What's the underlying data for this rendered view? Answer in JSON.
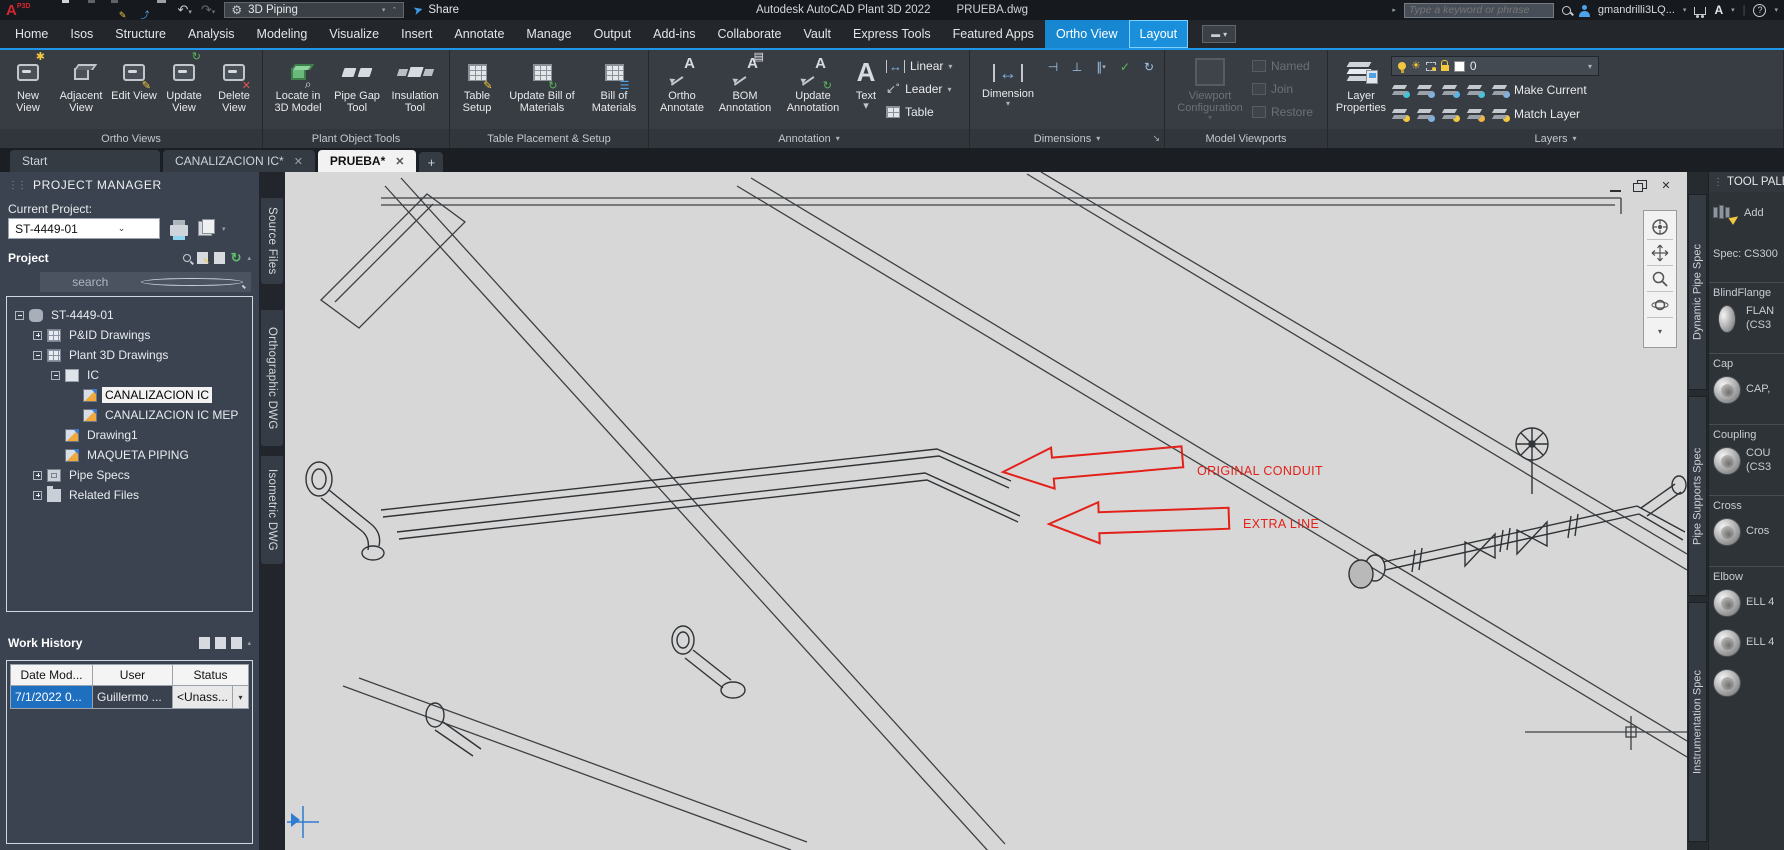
{
  "colors": {
    "accent": "#1787d2",
    "annotation_red": "#e32119",
    "selection_blue": "#1e6fc0",
    "canvas_gray": "#d7d7d7"
  },
  "title_bar": {
    "logo": "P3D",
    "workspace": "3D Piping",
    "share_label": "Share",
    "app_title": "Autodesk AutoCAD Plant 3D 2022",
    "doc_title": "PRUEBA.dwg",
    "search_placeholder": "Type a keyword or phrase",
    "user": "gmandrilli3LQ..."
  },
  "menu": {
    "tabs": [
      {
        "label": "Home"
      },
      {
        "label": "Isos"
      },
      {
        "label": "Structure"
      },
      {
        "label": "Analysis"
      },
      {
        "label": "Modeling"
      },
      {
        "label": "Visualize"
      },
      {
        "label": "Insert"
      },
      {
        "label": "Annotate"
      },
      {
        "label": "Manage"
      },
      {
        "label": "Output"
      },
      {
        "label": "Add-ins"
      },
      {
        "label": "Collaborate"
      },
      {
        "label": "Vault"
      },
      {
        "label": "Express Tools"
      },
      {
        "label": "Featured Apps"
      },
      {
        "label": "Ortho View",
        "active": true
      },
      {
        "label": "Layout",
        "active": true
      }
    ]
  },
  "ribbon": {
    "ortho_views": {
      "label": "Ortho Views",
      "buttons": [
        "New View",
        "Adjacent View",
        "Edit View",
        "Update View",
        "Delete View"
      ]
    },
    "plant_tools": {
      "label": "Plant Object Tools",
      "buttons": [
        "Locate in 3D Model",
        "Pipe Gap Tool",
        "Insulation Tool"
      ]
    },
    "table_setup": {
      "label": "Table Placement & Setup",
      "buttons": [
        "Table Setup",
        "Update Bill of Materials",
        "Bill of Materials"
      ]
    },
    "annotation": {
      "label": "Annotation",
      "buttons": [
        "Ortho Annotate",
        "BOM Annotation",
        "Update Annotation",
        "Text"
      ],
      "side": [
        "Linear",
        "Leader",
        "Table"
      ]
    },
    "dimensions": {
      "label": "Dimensions",
      "main": "Dimension"
    },
    "model_viewports": {
      "label": "Model Viewports",
      "main": "Viewport Configuration",
      "side": [
        "Named",
        "Join",
        "Restore"
      ]
    },
    "layers": {
      "label": "Layers",
      "main": "Layer Properties",
      "current_layer": "0",
      "actions": [
        "Make Current",
        "Match Layer"
      ]
    }
  },
  "file_tabs": {
    "tabs": [
      {
        "label": "Start"
      },
      {
        "label": "CANALIZACION IC*",
        "closable": true
      },
      {
        "label": "PRUEBA*",
        "closable": true,
        "active": true
      }
    ],
    "add": "+"
  },
  "project_manager": {
    "title": "PROJECT MANAGER",
    "current_project_label": "Current Project:",
    "current_project": "ST-4449-01",
    "section_title": "Project",
    "search_placeholder": "search",
    "tree": [
      {
        "label": "ST-4449-01"
      },
      {
        "label": "P&ID Drawings"
      },
      {
        "label": "Plant 3D Drawings"
      },
      {
        "label": "IC"
      },
      {
        "label": "CANALIZACION IC",
        "selected": true
      },
      {
        "label": "CANALIZACION IC MEP"
      },
      {
        "label": "Drawing1"
      },
      {
        "label": "MAQUETA PIPING"
      },
      {
        "label": "Pipe Specs"
      },
      {
        "label": "Related Files"
      }
    ],
    "work_history": {
      "title": "Work History",
      "columns": [
        "Date Mod...",
        "User",
        "Status"
      ],
      "row": {
        "date": "7/1/2022 0...",
        "user": "Guillermo ...",
        "status": "<Unass..."
      }
    }
  },
  "left_tabs": [
    {
      "label": "Source Files"
    },
    {
      "label": "Orthographic DWG"
    },
    {
      "label": "Isometric DWG"
    }
  ],
  "canvas": {
    "annotations": [
      {
        "label": "ORIGINAL CONDUIT"
      },
      {
        "label": "EXTRA LINE"
      }
    ]
  },
  "tool_palettes": {
    "header": "TOOL PALE",
    "tabs": [
      {
        "label": "Dynamic Pipe Spec"
      },
      {
        "label": "Pipe Supports Spec"
      },
      {
        "label": "Instrumentation Spec"
      }
    ],
    "add_label": "Add",
    "spec_label": "Spec: CS300",
    "sections": [
      {
        "title": "BlindFlange",
        "items": [
          {
            "line1": "FLAN",
            "line2": "(CS3"
          }
        ]
      },
      {
        "title": "Cap",
        "items": [
          {
            "line1": "CAP,"
          }
        ]
      },
      {
        "title": "Coupling",
        "items": [
          {
            "line1": "COU",
            "line2": "(CS3"
          }
        ]
      },
      {
        "title": "Cross",
        "items": [
          {
            "line1": "Cros"
          }
        ]
      },
      {
        "title": "Elbow",
        "items": [
          {
            "line1": "ELL 4"
          },
          {
            "line1": "ELL 4"
          }
        ]
      }
    ]
  }
}
